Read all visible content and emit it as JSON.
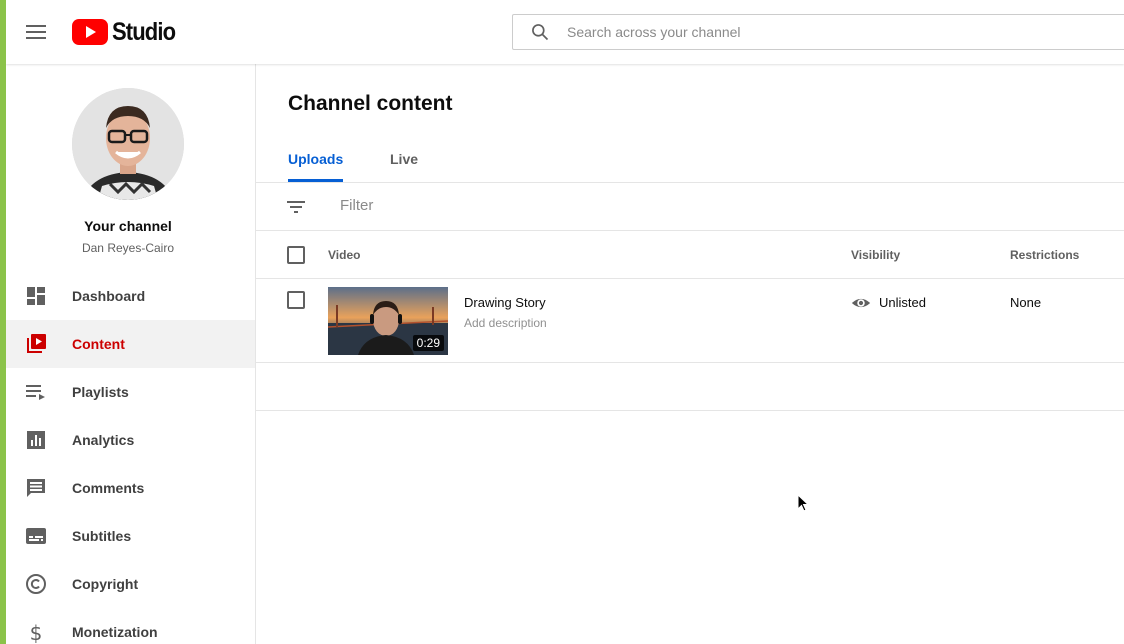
{
  "header": {
    "logo_text": "Studio",
    "search_placeholder": "Search across your channel"
  },
  "channel": {
    "title": "Your channel",
    "name": "Dan Reyes-Cairo"
  },
  "sidebar": {
    "items": [
      {
        "label": "Dashboard",
        "icon": "dashboard-icon",
        "active": false
      },
      {
        "label": "Content",
        "icon": "content-icon",
        "active": true
      },
      {
        "label": "Playlists",
        "icon": "playlists-icon",
        "active": false
      },
      {
        "label": "Analytics",
        "icon": "analytics-icon",
        "active": false
      },
      {
        "label": "Comments",
        "icon": "comments-icon",
        "active": false
      },
      {
        "label": "Subtitles",
        "icon": "subtitles-icon",
        "active": false
      },
      {
        "label": "Copyright",
        "icon": "copyright-icon",
        "active": false
      },
      {
        "label": "Monetization",
        "icon": "monetization-icon",
        "active": false
      }
    ]
  },
  "main": {
    "title": "Channel content",
    "tabs": [
      {
        "label": "Uploads",
        "active": true
      },
      {
        "label": "Live",
        "active": false
      }
    ],
    "filter_placeholder": "Filter",
    "columns": {
      "video": "Video",
      "visibility": "Visibility",
      "restrictions": "Restrictions"
    },
    "rows": [
      {
        "title": "Drawing Story",
        "description": "Add description",
        "duration": "0:29",
        "visibility": "Unlisted",
        "restrictions": "None"
      }
    ]
  },
  "colors": {
    "accent_blue": "#065fd4",
    "active_red": "#cc0000",
    "brand_red": "#ff0000",
    "left_accent_green": "#8bc34a"
  }
}
